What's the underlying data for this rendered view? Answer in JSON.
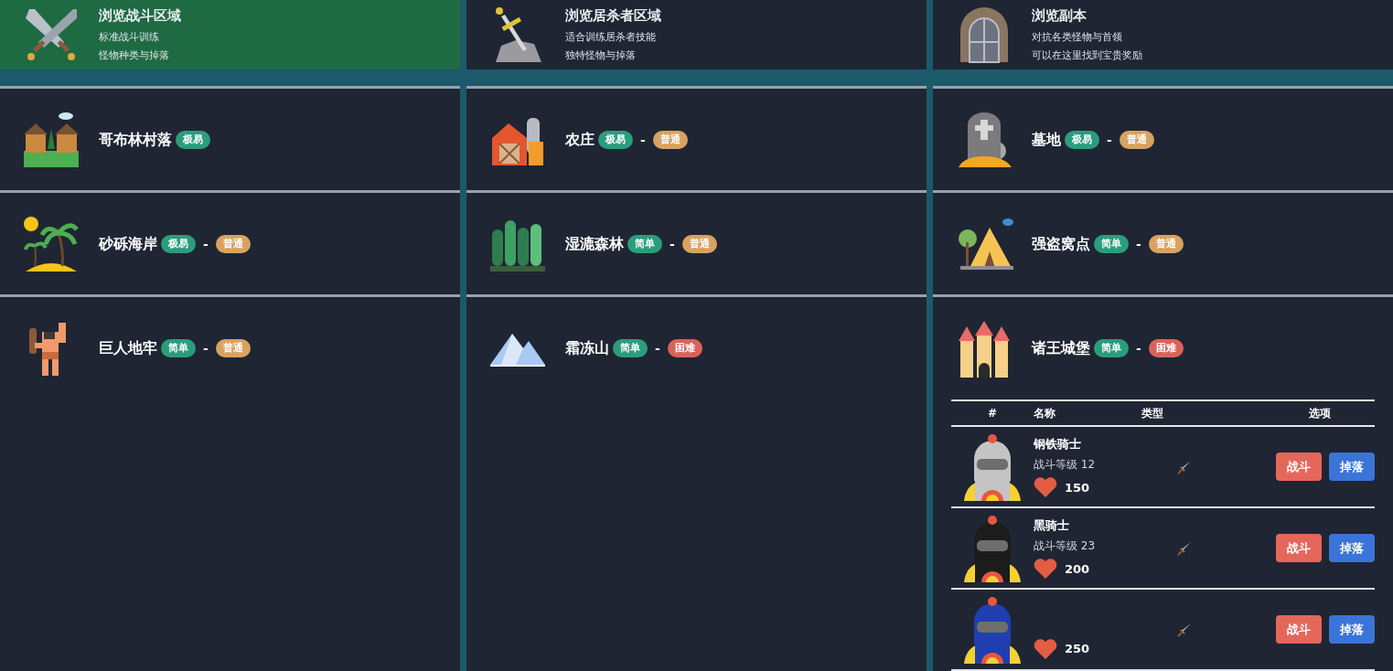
{
  "sections": [
    {
      "title": "浏览战斗区域",
      "lines": [
        "标准战斗训练",
        "怪物种类与掉落"
      ],
      "selected": true
    },
    {
      "title": "浏览居杀者区域",
      "lines": [
        "适合训练居杀者技能",
        "独特怪物与掉落"
      ],
      "selected": false
    },
    {
      "title": "浏览副本",
      "lines": [
        "对抗各类怪物与首领",
        "可以在这里找到宝贵奖励"
      ],
      "selected": false
    }
  ],
  "areas": [
    {
      "name": "哥布林村落",
      "badges": [
        {
          "kind": "easiest",
          "text": "极易"
        }
      ]
    },
    {
      "name": "农庄",
      "badges": [
        {
          "kind": "easiest",
          "text": "极易"
        },
        {
          "kind": "normal",
          "text": "普通"
        }
      ],
      "separator": "-"
    },
    {
      "name": "墓地",
      "badges": [
        {
          "kind": "easiest",
          "text": "极易"
        },
        {
          "kind": "normal",
          "text": "普通"
        }
      ],
      "separator": "-"
    },
    {
      "name": "砂砾海岸",
      "badges": [
        {
          "kind": "easiest",
          "text": "极易"
        },
        {
          "kind": "normal",
          "text": "普通"
        }
      ],
      "separator": "-"
    },
    {
      "name": "湿漉森林",
      "badges": [
        {
          "kind": "easy",
          "text": "简单"
        },
        {
          "kind": "normal",
          "text": "普通"
        }
      ],
      "separator": "-"
    },
    {
      "name": "强盗窝点",
      "badges": [
        {
          "kind": "easy",
          "text": "简单"
        },
        {
          "kind": "normal",
          "text": "普通"
        }
      ],
      "separator": "-"
    },
    {
      "name": "巨人地牢",
      "badges": [
        {
          "kind": "easy",
          "text": "简单"
        },
        {
          "kind": "normal",
          "text": "普通"
        }
      ],
      "separator": "-"
    },
    {
      "name": "霜冻山",
      "badges": [
        {
          "kind": "easy",
          "text": "简单"
        },
        {
          "kind": "hard",
          "text": "困难"
        }
      ],
      "separator": "-"
    },
    {
      "name": "诸王城堡",
      "badges": [
        {
          "kind": "easy",
          "text": "简单"
        },
        {
          "kind": "hard",
          "text": "困难"
        }
      ],
      "separator": "-"
    }
  ],
  "monster_table": {
    "columns": [
      "#",
      "名称",
      "类型",
      "选项"
    ],
    "rows": [
      {
        "color": "#c4c4c4",
        "name": "钢铁骑士",
        "level_text": "战斗等级 12",
        "hp": "150",
        "fight": "战斗",
        "drops": "掉落"
      },
      {
        "color": "#1c1c1c",
        "name": "黑骑士",
        "level_text": "战斗等级 23",
        "hp": "200",
        "fight": "战斗",
        "drops": "掉落"
      },
      {
        "color": "#1f3fb0",
        "hp": "250",
        "fight": "战斗",
        "drops": "掉落"
      }
    ]
  }
}
